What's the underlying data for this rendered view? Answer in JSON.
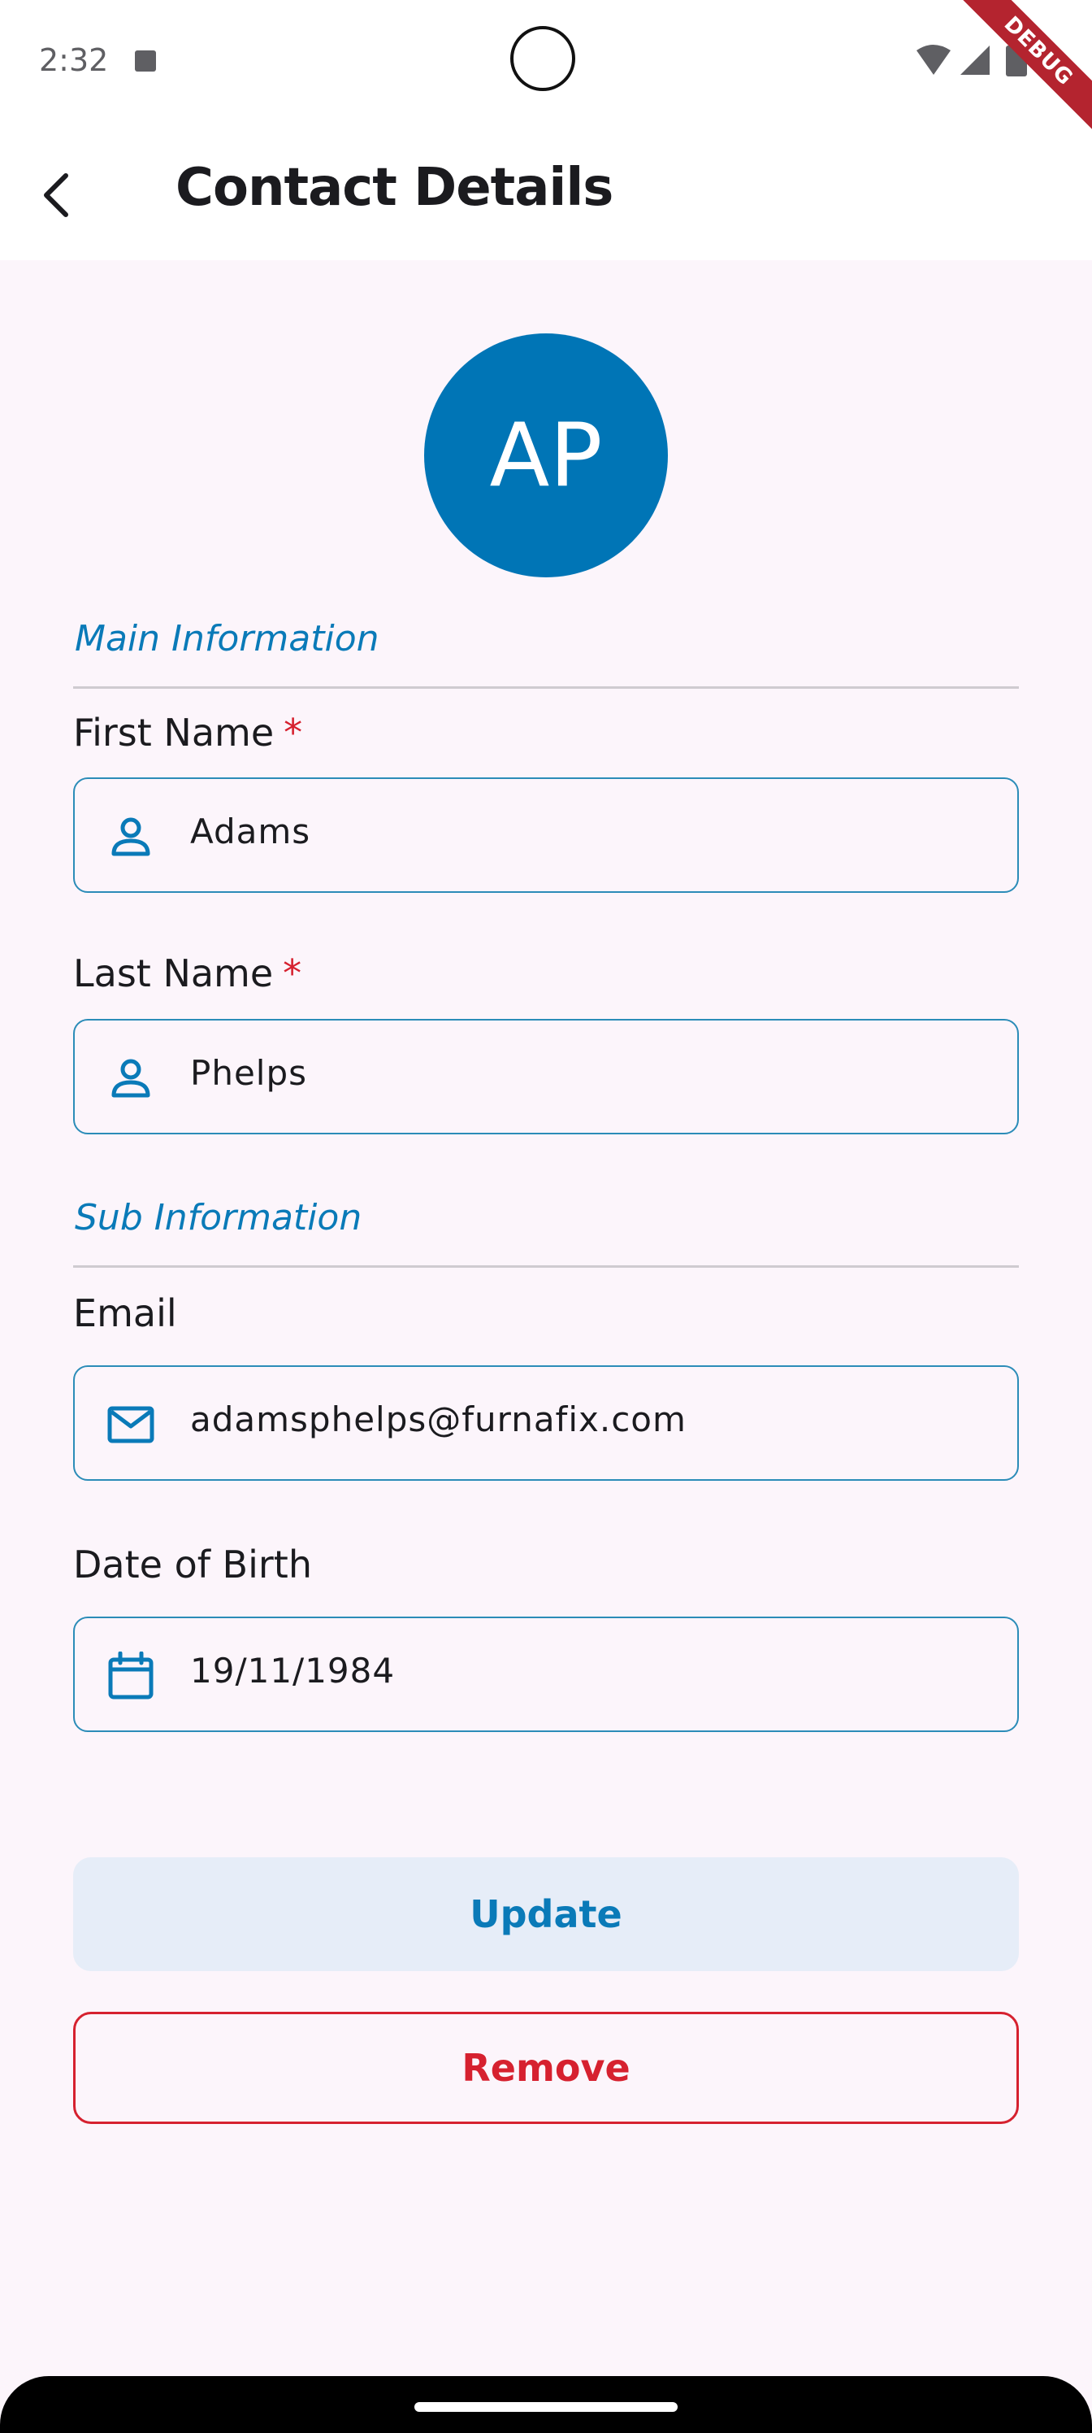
{
  "status_bar": {
    "time": "2:32",
    "debug_label": "DEBUG"
  },
  "app_bar": {
    "title": "Contact Details"
  },
  "avatar": {
    "initials": "AP",
    "color": "#0075b6"
  },
  "sections": {
    "main_title": "Main Information",
    "sub_title": "Sub Information"
  },
  "fields": {
    "first_name": {
      "label": "First Name",
      "required_mark": "*",
      "value": "Adams",
      "icon": "person-icon"
    },
    "last_name": {
      "label": "Last Name",
      "required_mark": "*",
      "value": "Phelps",
      "icon": "person-icon"
    },
    "email": {
      "label": "Email",
      "value": "adamsphelps@furnafix.com",
      "icon": "mail-icon"
    },
    "dob": {
      "label": "Date of Birth",
      "value": "19/11/1984",
      "icon": "calendar-icon"
    }
  },
  "actions": {
    "update_label": "Update",
    "remove_label": "Remove"
  },
  "colors": {
    "accent": "#0a7ab8",
    "danger": "#d6212f",
    "background": "#fcf5fb"
  }
}
